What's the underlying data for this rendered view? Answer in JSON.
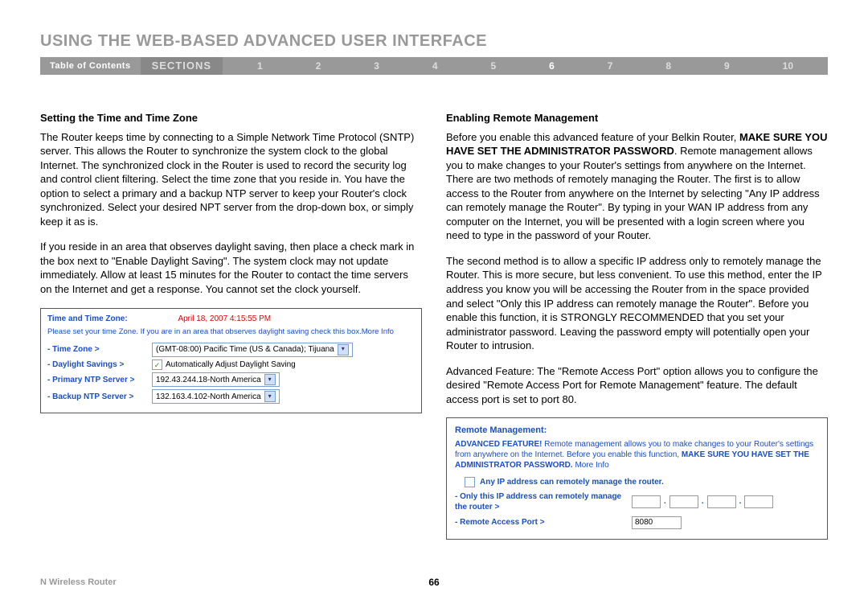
{
  "title": "USING THE WEB-BASED ADVANCED USER INTERFACE",
  "nav": {
    "toc": "Table of Contents",
    "sections": "SECTIONS",
    "items": [
      "1",
      "2",
      "3",
      "4",
      "5",
      "6",
      "7",
      "8",
      "9",
      "10"
    ],
    "active": "6"
  },
  "left": {
    "heading": "Setting the Time and Time Zone",
    "p1": "The Router keeps time by connecting to a Simple Network Time Protocol (SNTP) server. This allows the Router to synchronize the system clock to the global Internet. The synchronized clock in the Router is used to record the security log and control client filtering. Select the time zone that you reside in. You have the option to select a primary and a backup NTP server to keep your Router's clock synchronized. Select your desired NPT server from the drop-down box, or simply keep it as is.",
    "p2": "If you reside in an area that observes daylight saving, then place a check mark in the box next to \"Enable Daylight Saving\". The system clock may not update immediately. Allow at least 15 minutes for the Router to contact the time servers on the Internet and get a response. You cannot set the clock yourself.",
    "box": {
      "title": "Time and Time Zone:",
      "date": "April 18, 2007    4:15:55 PM",
      "note": "Please set your time Zone. If you are in an area that observes daylight saving check this box.More Info",
      "tz_label": "- Time Zone >",
      "tz_value": "(GMT-08:00) Pacific Time (US & Canada); Tijuana",
      "ds_label": "- Daylight Savings >",
      "ds_text": "Automatically Adjust Daylight Saving",
      "pntp_label": "- Primary NTP Server >",
      "pntp_value": "192.43.244.18-North America",
      "bntp_label": "- Backup NTP Server >",
      "bntp_value": "132.163.4.102-North America"
    }
  },
  "right": {
    "heading": "Enabling Remote Management",
    "p1a": "Before you enable this advanced feature of your Belkin Router, ",
    "p1b": "MAKE SURE YOU HAVE SET THE ADMINISTRATOR PASSWORD",
    "p1c": ". Remote management allows you to make changes to your Router's settings from anywhere on the Internet. There are two methods of remotely managing the Router. The first is to allow access to the Router from anywhere on the Internet by selecting \"Any IP address can remotely manage the Router\". By typing in your WAN IP address from any computer on the Internet, you will be presented with a login screen where you need to type in the password of your Router.",
    "p2": "The second method is to allow a specific IP address only to remotely manage the Router. This is more secure, but less convenient. To use this method, enter the IP address you know you will be accessing the Router from in the space provided and select \"Only this IP address can remotely manage the Router\". Before you enable this function, it is STRONGLY RECOMMENDED that you set your administrator password. Leaving the password empty will potentially open your Router to intrusion.",
    "p3": "Advanced Feature: The \"Remote Access Port\" option allows you to configure the desired \"Remote Access Port for Remote Management\" feature. The default access port is set to port 80.",
    "box": {
      "title": "Remote Management:",
      "desc_a": "ADVANCED FEATURE!",
      "desc_b": " Remote management allows you to make changes to your Router's settings from anywhere on the Internet. Before you enable this function, ",
      "desc_c": "MAKE SURE YOU HAVE SET THE ADMINISTRATOR PASSWORD. ",
      "desc_d": "More Info",
      "anyip": "Any IP address can remotely manage the router.",
      "onlyip": "- Only this IP address can remotely manage the router >",
      "port_label": "- Remote Access Port >",
      "port_value": "8080"
    }
  },
  "footer": {
    "left": "N Wireless Router",
    "page": "66"
  }
}
